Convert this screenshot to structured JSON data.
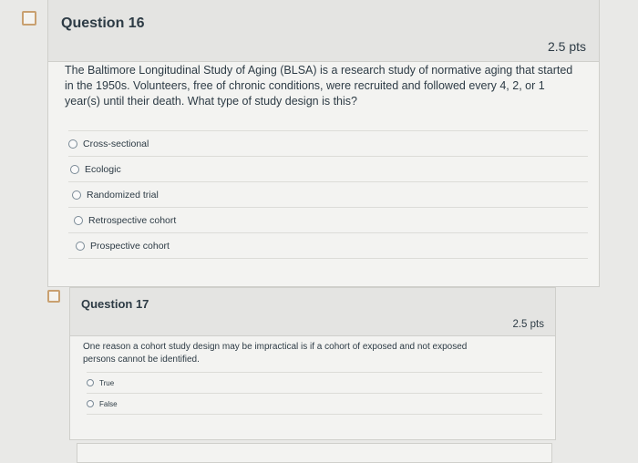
{
  "questions": [
    {
      "title": "Question 16",
      "points": "2.5 pts",
      "text_lines": [
        "The Baltimore Longitudinal Study of Aging (BLSA) is a research study of normative aging that started",
        "in the 1950s. Volunteers, free of chronic conditions, were recruited and followed every 4, 2, or 1",
        "year(s) until their death. What type of study design is this?"
      ],
      "options": [
        "Cross-sectional",
        "Ecologic",
        "Randomized trial",
        "Retrospective cohort",
        "Prospective cohort"
      ]
    },
    {
      "title": "Question 17",
      "points": "2.5 pts",
      "text_lines": [
        "One reason a cohort study design may be impractical is if a cohort of exposed and not exposed",
        "persons cannot be identified."
      ],
      "options": [
        "True",
        "False"
      ]
    }
  ]
}
